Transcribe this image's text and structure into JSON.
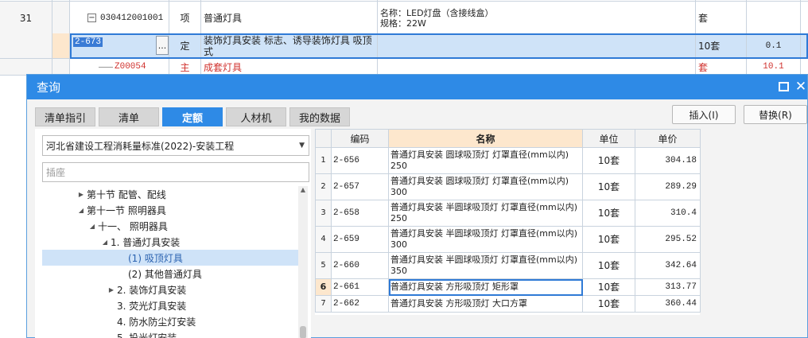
{
  "sheet": {
    "row31": {
      "index": "31",
      "code": "030412001001",
      "type": "项",
      "name": "普通灯具",
      "feature_line1": "名称：LED灯盘（含接线盒）",
      "feature_line2": "规格：22W",
      "unit": "套"
    },
    "row_selected": {
      "code": "2-673",
      "type": "定",
      "name": "装饰灯具安装 标志、诱导装饰灯具 吸顶式",
      "unit": "10套",
      "quantity": "0.1",
      "more_label": "..."
    },
    "row_sub": {
      "code": "Z00054",
      "type": "主",
      "name": "成套灯具",
      "unit": "套",
      "quantity": "10.1"
    }
  },
  "dialog": {
    "title": "查询",
    "tabs": [
      "清单指引",
      "清单",
      "定额",
      "人材机",
      "我的数据"
    ],
    "active_tab": "定额",
    "insert_label": "插入(I)",
    "replace_label": "替换(R)",
    "standard": "河北省建设工程消耗量标准(2022)-安装工程",
    "search_placeholder": "插座",
    "tree": [
      {
        "label": "第十节 配管、配线",
        "toggle": "right"
      },
      {
        "label": "第十一节 照明器具",
        "toggle": "down"
      },
      {
        "label": "十一、 照明器具",
        "toggle": "down"
      },
      {
        "label": "1. 普通灯具安装",
        "toggle": "down"
      },
      {
        "label": "(1) 吸顶灯具",
        "toggle": "none",
        "selected": true
      },
      {
        "label": "(2) 其他普通灯具",
        "toggle": "none"
      },
      {
        "label": "2. 装饰灯具安装",
        "toggle": "right"
      },
      {
        "label": "3. 荧光灯具安装",
        "toggle": "none"
      },
      {
        "label": "4. 防水防尘灯安装",
        "toggle": "none"
      },
      {
        "label": "5. 投光灯安装",
        "toggle": "none"
      }
    ],
    "table": {
      "headers": [
        "",
        "编码",
        "名称",
        "单位",
        "单价"
      ],
      "rows": [
        {
          "num": "1",
          "code": "2-656",
          "name": "普通灯具安装 圆球吸顶灯 灯罩直径(mm以内) 250",
          "unit": "10套",
          "price": "304.18"
        },
        {
          "num": "2",
          "code": "2-657",
          "name": "普通灯具安装 圆球吸顶灯 灯罩直径(mm以内) 300",
          "unit": "10套",
          "price": "289.29"
        },
        {
          "num": "3",
          "code": "2-658",
          "name": "普通灯具安装 半圆球吸顶灯 灯罩直径(mm以内) 250",
          "unit": "10套",
          "price": "310.4"
        },
        {
          "num": "4",
          "code": "2-659",
          "name": "普通灯具安装 半圆球吸顶灯 灯罩直径(mm以内) 300",
          "unit": "10套",
          "price": "295.52"
        },
        {
          "num": "5",
          "code": "2-660",
          "name": "普通灯具安装 半圆球吸顶灯 灯罩直径(mm以内) 350",
          "unit": "10套",
          "price": "342.64"
        },
        {
          "num": "6",
          "code": "2-661",
          "name": "普通灯具安装 方形吸顶灯 矩形罩",
          "unit": "10套",
          "price": "313.77"
        },
        {
          "num": "7",
          "code": "2-662",
          "name": "普通灯具安装 方形吸顶灯 大口方罩",
          "unit": "10套",
          "price": "360.44"
        }
      ]
    }
  },
  "colors": {
    "accent": "#2e8ae6",
    "selection": "#cfe3f8",
    "header_highlight": "#fde7cd",
    "sub_item_red": "#d0312d"
  }
}
